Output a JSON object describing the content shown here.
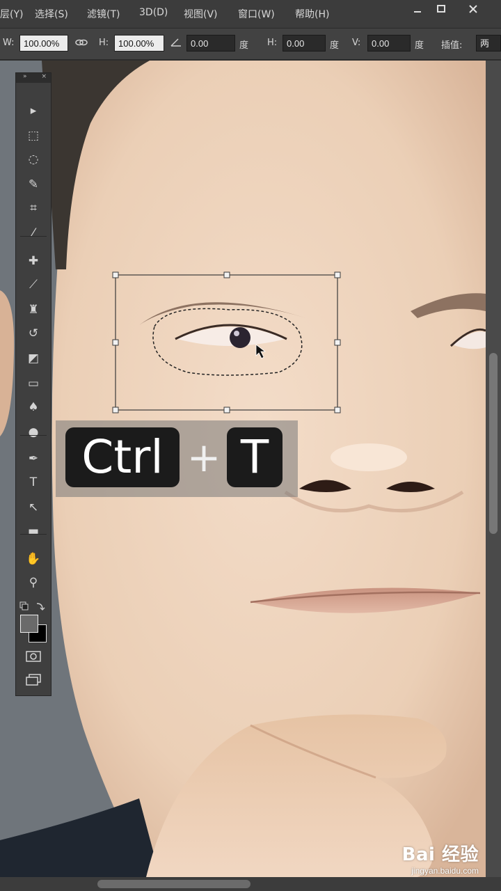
{
  "menu": {
    "items": [
      "图层(Y)",
      "选择(S)",
      "滤镜(T)",
      "3D(D)",
      "视图(V)",
      "窗口(W)",
      "帮助(H)"
    ],
    "window_controls": [
      "minimize-icon",
      "maximize-icon",
      "close-icon"
    ]
  },
  "options_bar": {
    "w_label": "W:",
    "w_value": "100.00%",
    "link_icon": "link-icon",
    "h_label": "H:",
    "h_value": "100.00%",
    "angle_icon": "angle-icon",
    "angle_value": "0.00",
    "degree_unit": "度",
    "skew_h_label": "H:",
    "skew_h_value": "0.00",
    "skew_h_unit": "度",
    "skew_v_label": "V:",
    "skew_v_value": "0.00",
    "skew_v_unit": "度",
    "interp_label": "插值:",
    "interp_value": "两"
  },
  "tools": [
    {
      "name": "move-tool-icon",
      "glyph": "▸"
    },
    {
      "name": "marquee-tool-icon",
      "glyph": "⬚"
    },
    {
      "name": "lasso-tool-icon",
      "glyph": "◌"
    },
    {
      "name": "quick-select-tool-icon",
      "glyph": "✎"
    },
    {
      "name": "crop-tool-icon",
      "glyph": "⌗"
    },
    {
      "name": "eyedropper-tool-icon",
      "glyph": "⁄"
    },
    {
      "name": "healing-brush-tool-icon",
      "glyph": "✚"
    },
    {
      "name": "brush-tool-icon",
      "glyph": "⟋"
    },
    {
      "name": "stamp-tool-icon",
      "glyph": "♜"
    },
    {
      "name": "history-brush-tool-icon",
      "glyph": "↺"
    },
    {
      "name": "eraser-tool-icon",
      "glyph": "◩"
    },
    {
      "name": "gradient-tool-icon",
      "glyph": "▭"
    },
    {
      "name": "blur-tool-icon",
      "glyph": "♠"
    },
    {
      "name": "dodge-tool-icon",
      "glyph": "●"
    },
    {
      "name": "pen-tool-icon",
      "glyph": "✒"
    },
    {
      "name": "type-tool-icon",
      "glyph": "T"
    },
    {
      "name": "path-select-tool-icon",
      "glyph": "↖"
    },
    {
      "name": "shape-tool-icon",
      "glyph": "▬"
    },
    {
      "name": "hand-tool-icon",
      "glyph": "✋"
    },
    {
      "name": "zoom-tool-icon",
      "glyph": "⚲"
    }
  ],
  "colors": {
    "foreground": "#6a6a6a",
    "background": "#000000",
    "skin": "#eacbb0"
  },
  "overlay": {
    "key1": "Ctrl",
    "plus": "+",
    "key2": "T"
  },
  "watermark": {
    "brand": "Bai 经验",
    "url": "jingyan.baidu.com"
  }
}
